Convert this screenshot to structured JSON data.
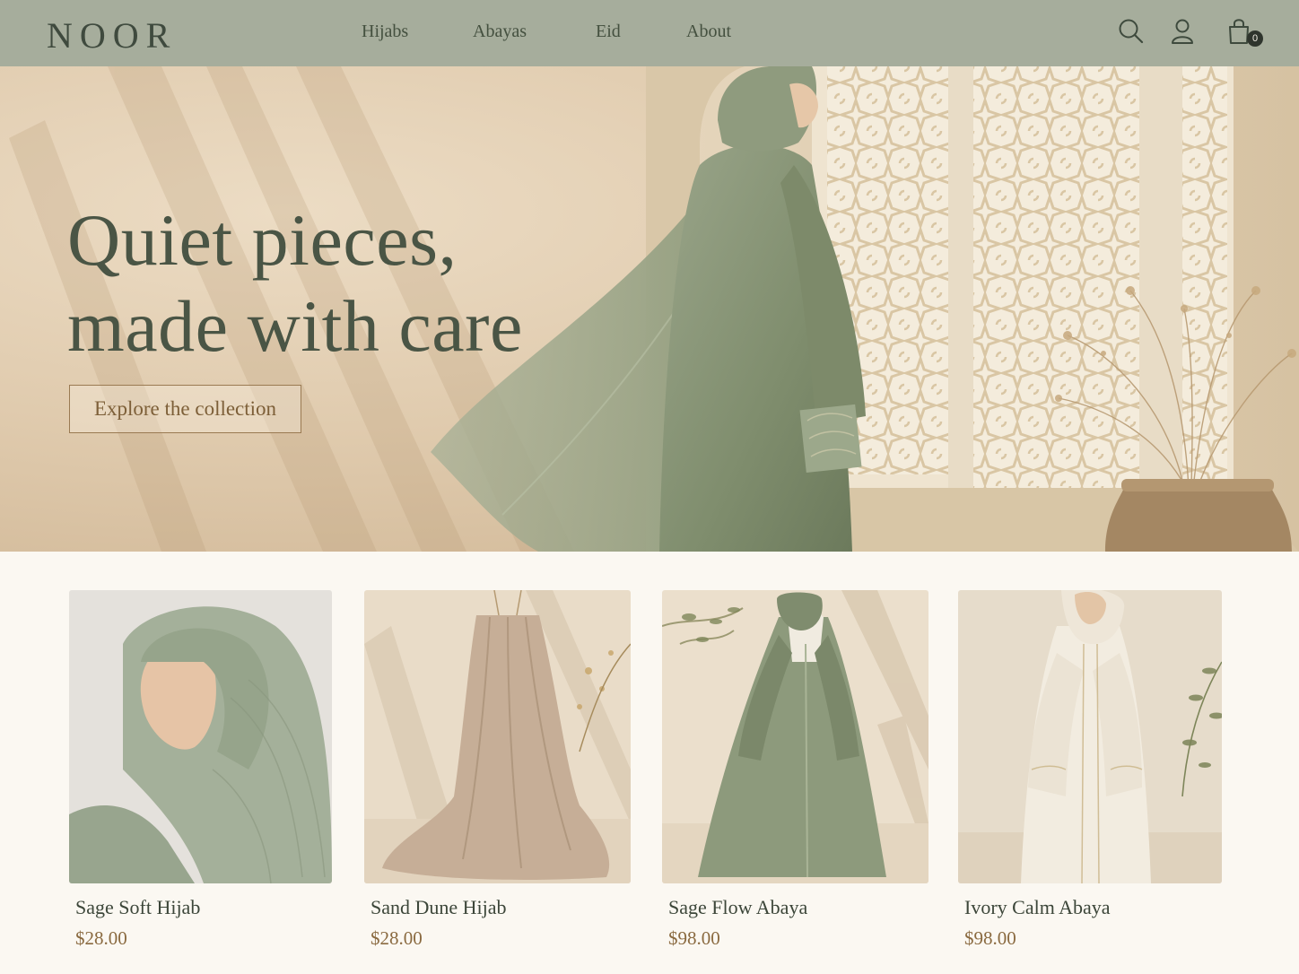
{
  "brand": {
    "logo": "NOOR"
  },
  "nav": {
    "items": [
      {
        "label": "Hijabs"
      },
      {
        "label": "Abayas"
      },
      {
        "label": "Eid"
      },
      {
        "label": "About"
      }
    ]
  },
  "header_icons": {
    "search": "search-icon",
    "account": "user-icon",
    "cart": "shopping-bag-icon",
    "cart_count": "0"
  },
  "hero": {
    "title_line1": "Quiet pieces,",
    "title_line2": "made with care",
    "cta_label": "Explore the collection"
  },
  "products": [
    {
      "name": "Sage Soft Hijab",
      "price": "$28.00"
    },
    {
      "name": "Sand Dune Hijab",
      "price": "$28.00"
    },
    {
      "name": "Sage Flow Abaya",
      "price": "$98.00"
    },
    {
      "name": "Ivory Calm Abaya",
      "price": "$98.00"
    }
  ],
  "colors": {
    "header_bg": "#a6ad9c",
    "page_bg": "#fbf8f2",
    "sage": "#8a9a7c",
    "accent_gold": "#8a6a40",
    "text_dark": "#3e4a3d"
  }
}
